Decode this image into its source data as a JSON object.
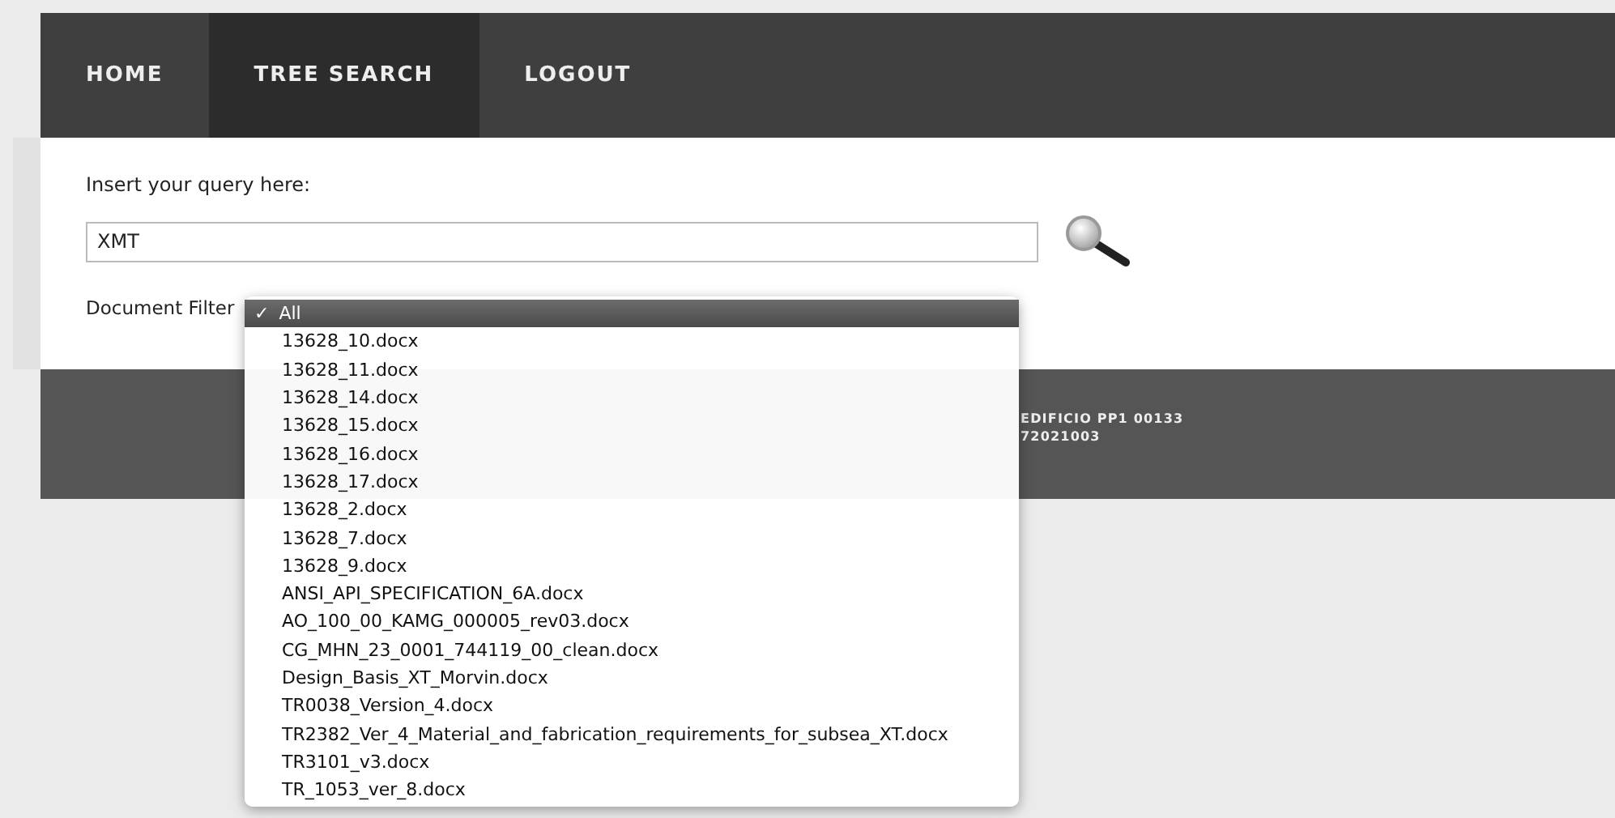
{
  "nav": [
    {
      "label": "HOME",
      "selected": false
    },
    {
      "label": "TREE SEARCH",
      "selected": true
    },
    {
      "label": "LOGOUT",
      "selected": false
    }
  ],
  "search": {
    "label": "Insert your query here:",
    "value": "XMT"
  },
  "filter": {
    "label": "Document Filter",
    "options": [
      {
        "label": "All",
        "selected": true
      },
      {
        "label": "13628_10.docx",
        "selected": false
      },
      {
        "label": "13628_11.docx",
        "selected": false
      },
      {
        "label": "13628_14.docx",
        "selected": false
      },
      {
        "label": "13628_15.docx",
        "selected": false
      },
      {
        "label": "13628_16.docx",
        "selected": false
      },
      {
        "label": "13628_17.docx",
        "selected": false
      },
      {
        "label": "13628_2.docx",
        "selected": false
      },
      {
        "label": "13628_7.docx",
        "selected": false
      },
      {
        "label": "13628_9.docx",
        "selected": false
      },
      {
        "label": "ANSI_API_SPECIFICATION_6A.docx",
        "selected": false
      },
      {
        "label": "AO_100_00_KAMG_000005_rev03.docx",
        "selected": false
      },
      {
        "label": "CG_MHN_23_0001_744119_00_clean.docx",
        "selected": false
      },
      {
        "label": "Design_Basis_XT_Morvin.docx",
        "selected": false
      },
      {
        "label": "TR0038_Version_4.docx",
        "selected": false
      },
      {
        "label": "TR2382_Ver_4_Material_and_fabrication_requirements_for_subsea_XT.docx",
        "selected": false
      },
      {
        "label": "TR3101_v3.docx",
        "selected": false
      },
      {
        "label": "TR_1053_ver_8.docx",
        "selected": false
      }
    ]
  },
  "check_mark": "✓",
  "footer": {
    "lines": [
      "EDIFICIO PP1 00133",
      "72021003"
    ]
  }
}
